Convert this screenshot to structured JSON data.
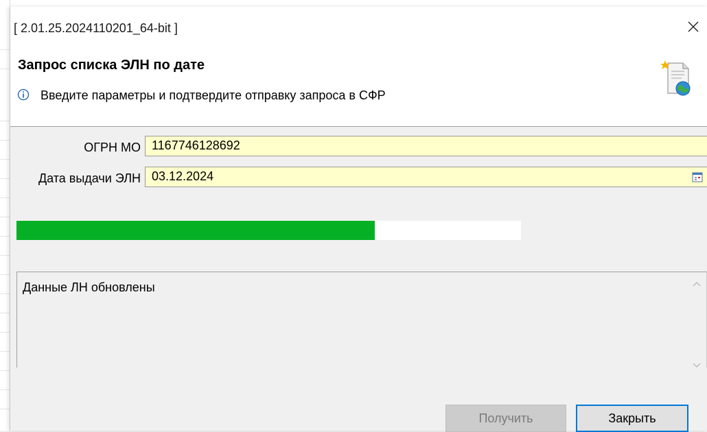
{
  "window": {
    "title": "[ 2.01.25.2024110201_64-bit ]"
  },
  "header": {
    "title": "Запрос списка ЭЛН по дате",
    "subtitle": "Введите параметры и подтвердите отправку запроса в СФР",
    "icon": "document-globe-icon",
    "info_icon": "info-icon"
  },
  "form": {
    "ogrn_label": "ОГРН МО",
    "ogrn_value": "1167746128692",
    "date_label": "Дата выдачи ЭЛН",
    "date_value": "03.12.2024"
  },
  "progress": {
    "percent": 71,
    "color": "#06b025"
  },
  "log": {
    "text": "Данные ЛН обновлены"
  },
  "buttons": {
    "get_label": "Получить",
    "get_enabled": false,
    "close_label": "Закрыть"
  },
  "colors": {
    "field_bg": "#ffffcc",
    "accent": "#0078d7"
  }
}
